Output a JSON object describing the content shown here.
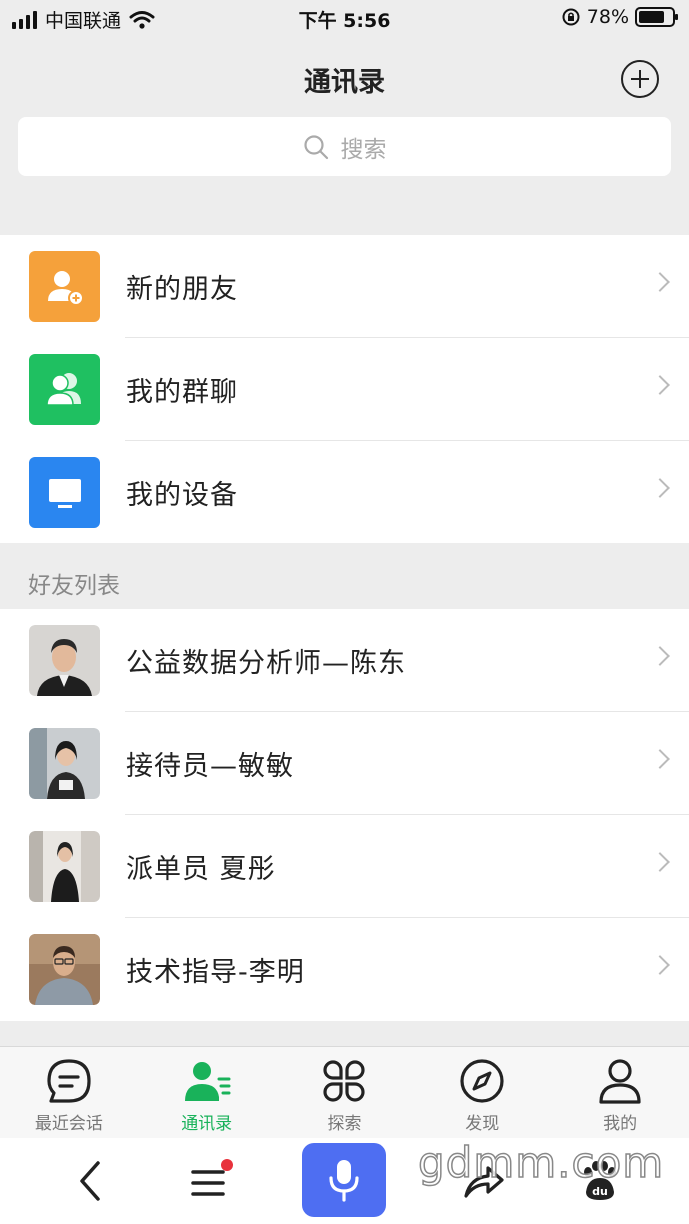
{
  "status_bar": {
    "carrier": "中国联通",
    "time": "下午 5:56",
    "battery": "78%",
    "battery_level": 0.78
  },
  "header": {
    "title": "通讯录"
  },
  "search": {
    "placeholder": "搜索"
  },
  "menu": [
    {
      "label": "新的朋友",
      "icon": "add-friend-icon",
      "color": "#f5a13b"
    },
    {
      "label": "我的群聊",
      "icon": "group-icon",
      "color": "#1fc061"
    },
    {
      "label": "我的设备",
      "icon": "monitor-icon",
      "color": "#2a86f0"
    }
  ],
  "friends_section": {
    "title": "好友列表"
  },
  "friends": [
    {
      "name": "公益数据分析师—陈东"
    },
    {
      "name": "接待员—敏敏"
    },
    {
      "name": "派单员 夏彤"
    },
    {
      "name": "技术指导-李明"
    }
  ],
  "tabs": [
    {
      "label": "最近会话",
      "icon": "chat-icon",
      "active": false
    },
    {
      "label": "通讯录",
      "icon": "contacts-icon",
      "active": true
    },
    {
      "label": "探索",
      "icon": "explore-icon",
      "active": false
    },
    {
      "label": "发现",
      "icon": "compass-icon",
      "active": false
    },
    {
      "label": "我的",
      "icon": "profile-icon",
      "active": false
    }
  ],
  "watermark": "gdmm.com",
  "colors": {
    "accent": "#19b25a",
    "mic": "#4e6ef2",
    "notification_dot": "#e8323c"
  }
}
